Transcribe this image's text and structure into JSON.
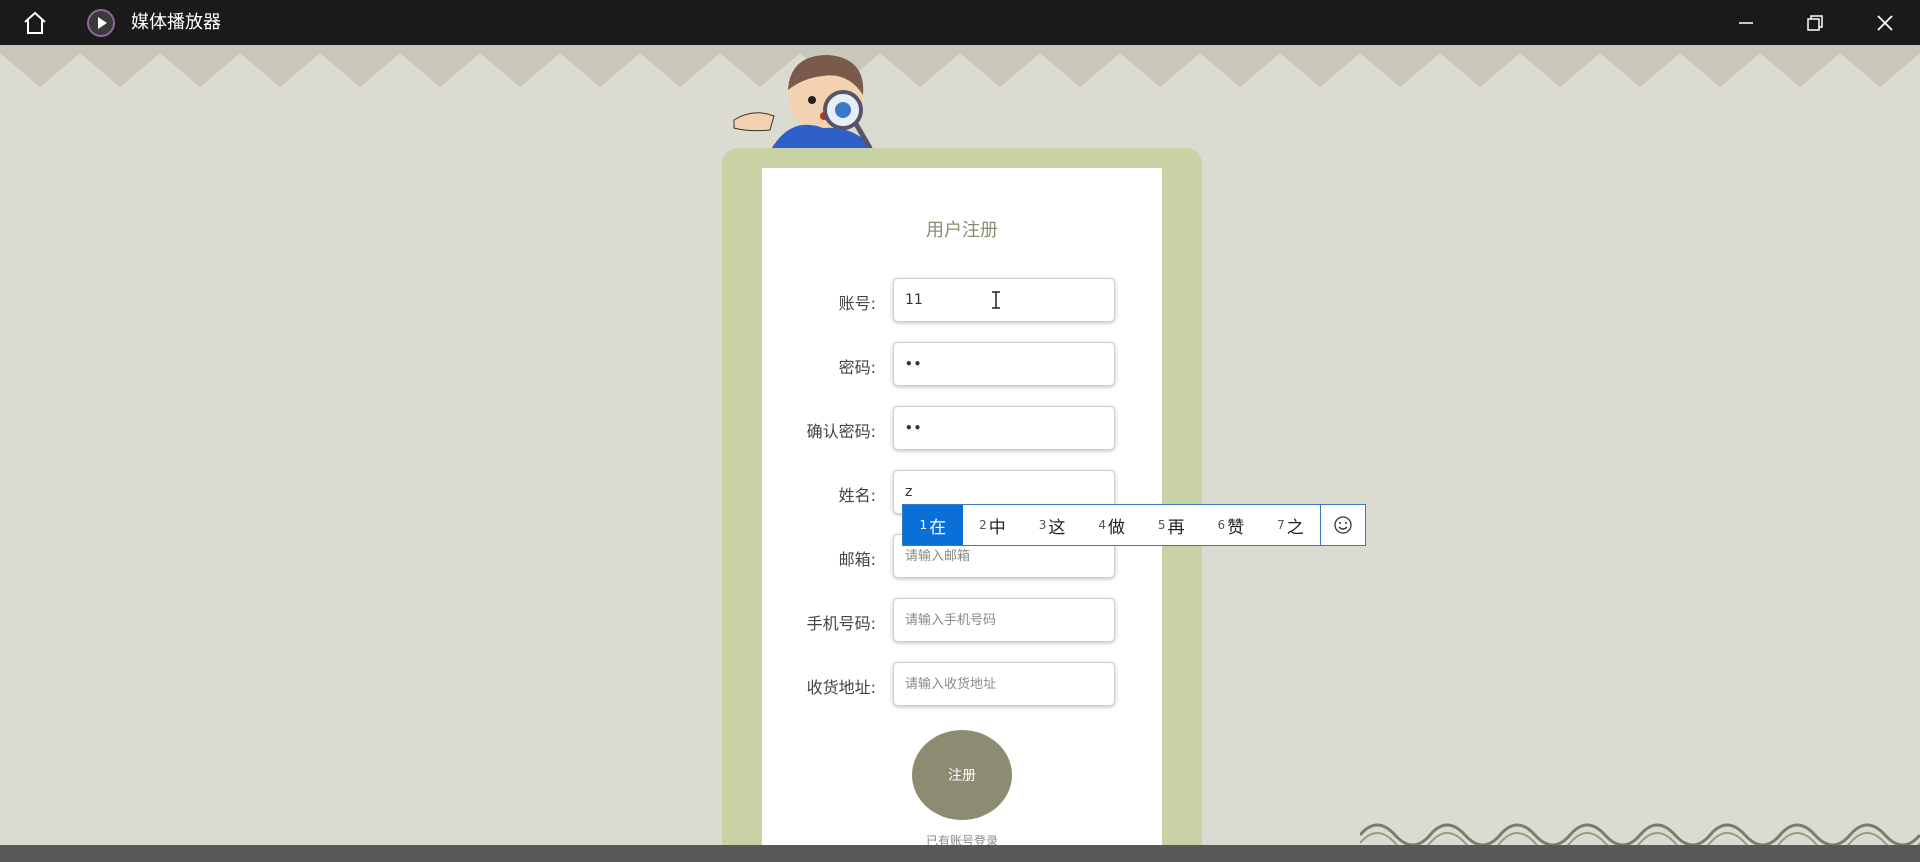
{
  "titlebar": {
    "app_title": "媒体播放器",
    "icons": [
      "home-icon",
      "play-icon",
      "minimize-icon",
      "restore-icon",
      "close-icon"
    ]
  },
  "form": {
    "title": "用户注册",
    "fields": [
      {
        "label": "账号:",
        "value": "11",
        "placeholder": ""
      },
      {
        "label": "密码:",
        "value": "••",
        "placeholder": ""
      },
      {
        "label": "确认密码:",
        "value": "••",
        "placeholder": ""
      },
      {
        "label": "姓名:",
        "value": "z",
        "placeholder": ""
      },
      {
        "label": "邮箱:",
        "value": "",
        "placeholder": "请输入邮箱"
      },
      {
        "label": "手机号码:",
        "value": "",
        "placeholder": "请输入手机号码"
      },
      {
        "label": "收货地址:",
        "value": "",
        "placeholder": "请输入收货地址"
      }
    ],
    "submit_label": "注册",
    "login_link": "已有账号登录"
  },
  "ime": {
    "candidates": [
      {
        "num": "1",
        "char": "在"
      },
      {
        "num": "2",
        "char": "中"
      },
      {
        "num": "3",
        "char": "这"
      },
      {
        "num": "4",
        "char": "做"
      },
      {
        "num": "5",
        "char": "再"
      },
      {
        "num": "6",
        "char": "赞"
      },
      {
        "num": "7",
        "char": "之"
      }
    ],
    "selected_index": 0
  },
  "colors": {
    "background": "#dcdbd2",
    "frame": "#c9d2a5",
    "accent": "#8d8c72",
    "ime_selected": "#0a6fd6"
  }
}
